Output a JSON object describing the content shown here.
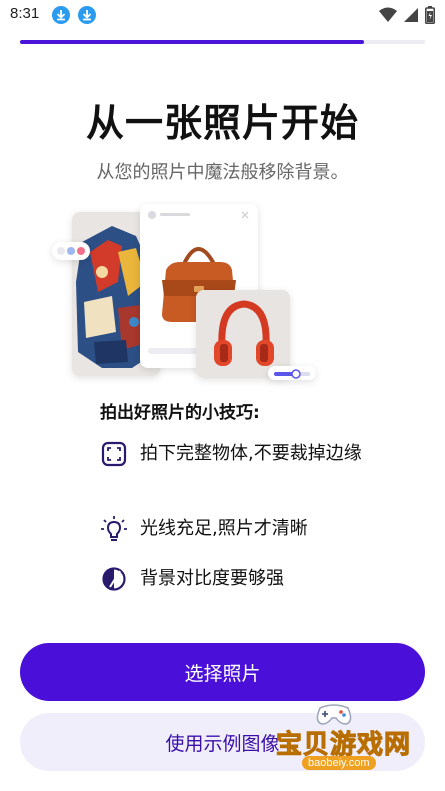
{
  "status_bar": {
    "time": "8:31",
    "icons": [
      "download-icon",
      "download-icon",
      "wifi-icon",
      "signal-icon",
      "battery-icon"
    ]
  },
  "progress": {
    "value_percent": 85
  },
  "header": {
    "title": "从一张照片开始",
    "subtitle": "从您的照片中魔法般移除背景。"
  },
  "tips": {
    "heading": "拍出好照片的小技巧:",
    "items": [
      {
        "icon": "frame-icon",
        "text": "拍下完整物体,不要裁掉边缘"
      },
      {
        "icon": "lightbulb-icon",
        "text": "光线充足,照片才清晰"
      },
      {
        "icon": "contrast-icon",
        "text": "背景对比度要够强"
      }
    ]
  },
  "buttons": {
    "primary_label": "选择照片",
    "secondary_label": "使用示例图像"
  },
  "watermark": {
    "text": "宝贝游戏网",
    "url": "baobeiy.com"
  },
  "colors": {
    "accent": "#4a0fd8",
    "secondary_bg": "#f1eefb",
    "secondary_text": "#3a0fa8",
    "progress_track": "#ececf2"
  }
}
